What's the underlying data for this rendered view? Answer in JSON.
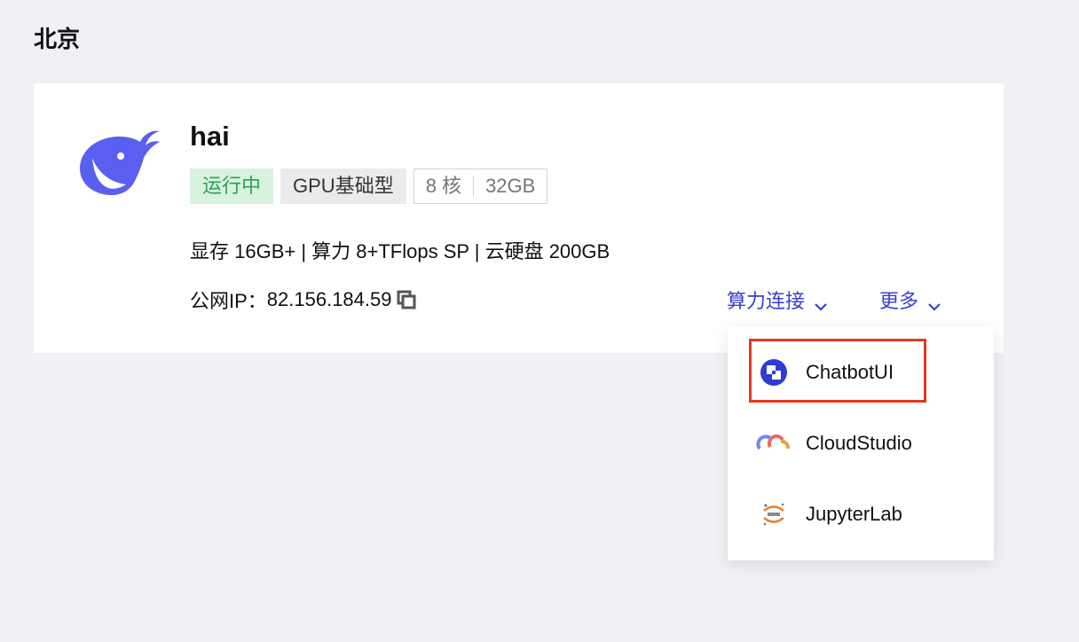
{
  "region": {
    "title": "北京"
  },
  "instance": {
    "name": "hai",
    "logo_icon": "deepseek-whale-icon",
    "tags": {
      "status": "运行中",
      "type": "GPU基础型",
      "cores": "8 核",
      "memory": "32GB"
    },
    "specs": "显存 16GB+ | 算力 8+TFlops SP | 云硬盘 200GB",
    "ip_label": "公网IP：",
    "ip_value": "82.156.184.59"
  },
  "actions": {
    "connect_label": "算力连接",
    "more_label": "更多"
  },
  "dropdown": {
    "items": [
      {
        "label": "ChatbotUI",
        "icon": "chatbotui-icon"
      },
      {
        "label": "CloudStudio",
        "icon": "cloudstudio-icon"
      },
      {
        "label": "JupyterLab",
        "icon": "jupyter-icon"
      }
    ]
  },
  "colors": {
    "accent": "#3a3fd0",
    "status_bg": "#d8f2e0",
    "status_fg": "#2ea055",
    "highlight": "#e03a1e",
    "logo": "#5b5ff0"
  }
}
